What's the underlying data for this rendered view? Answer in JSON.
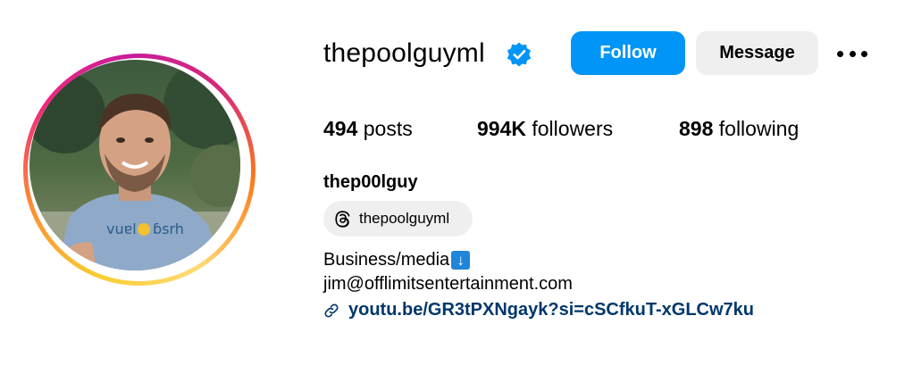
{
  "profile": {
    "username": "thepoolguyml",
    "verified_icon": "verified-badge-icon",
    "display_name": "thep00lguy"
  },
  "actions": {
    "follow_label": "Follow",
    "message_label": "Message",
    "more_icon": "more-options-icon"
  },
  "stats": {
    "posts_count": "494",
    "posts_label": "posts",
    "followers_count": "994K",
    "followers_label": "followers",
    "following_count": "898",
    "following_label": "following"
  },
  "threads": {
    "icon": "threads-icon",
    "handle": "thepoolguyml"
  },
  "bio": {
    "line1": "Business/media",
    "line1_emoji": "↓",
    "line2": "jim@offlimitsentertainment.com",
    "link_icon": "link-icon",
    "link": "youtu.be/GR3tPXNgayk?si=cSCfkuT-xGLCw7ku"
  },
  "colors": {
    "follow_button": "#0095f6",
    "secondary_button": "#efefef",
    "verified": "#0095f6",
    "link": "#00376b"
  }
}
